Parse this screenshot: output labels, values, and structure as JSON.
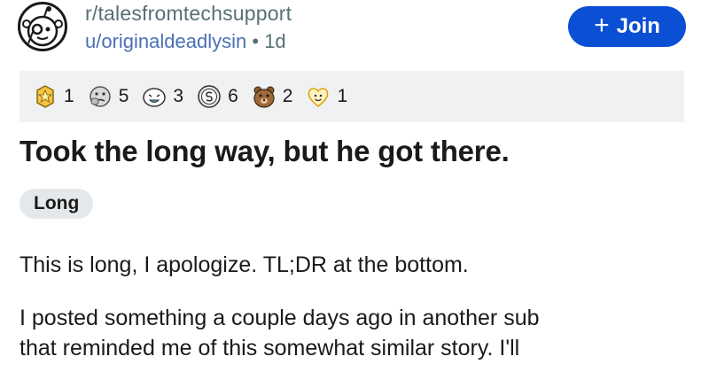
{
  "post": {
    "subreddit": "r/talesfromtechsupport",
    "author": "u/originaldeadlysin",
    "separator": "•",
    "age": "1d",
    "title": "Took the long way, but he got there.",
    "flair": "Long",
    "body": [
      "This is long, I apologize. TL;DR at the bottom.",
      "I posted something a couple days ago in another sub",
      "that reminded me of this somewhat similar story. I'll"
    ]
  },
  "join_button": {
    "label": "Join",
    "icon": "plus-icon",
    "color": "#0a4fd4"
  },
  "awards": [
    {
      "icon": "gold-star-award-icon",
      "count": "1"
    },
    {
      "icon": "thinking-face-award-icon",
      "count": "5"
    },
    {
      "icon": "laughing-face-award-icon",
      "count": "3"
    },
    {
      "icon": "snoo-coin-award-icon",
      "count": "6"
    },
    {
      "icon": "bear-face-award-icon",
      "count": "2"
    },
    {
      "icon": "wholesome-heart-award-icon",
      "count": "1"
    }
  ]
}
